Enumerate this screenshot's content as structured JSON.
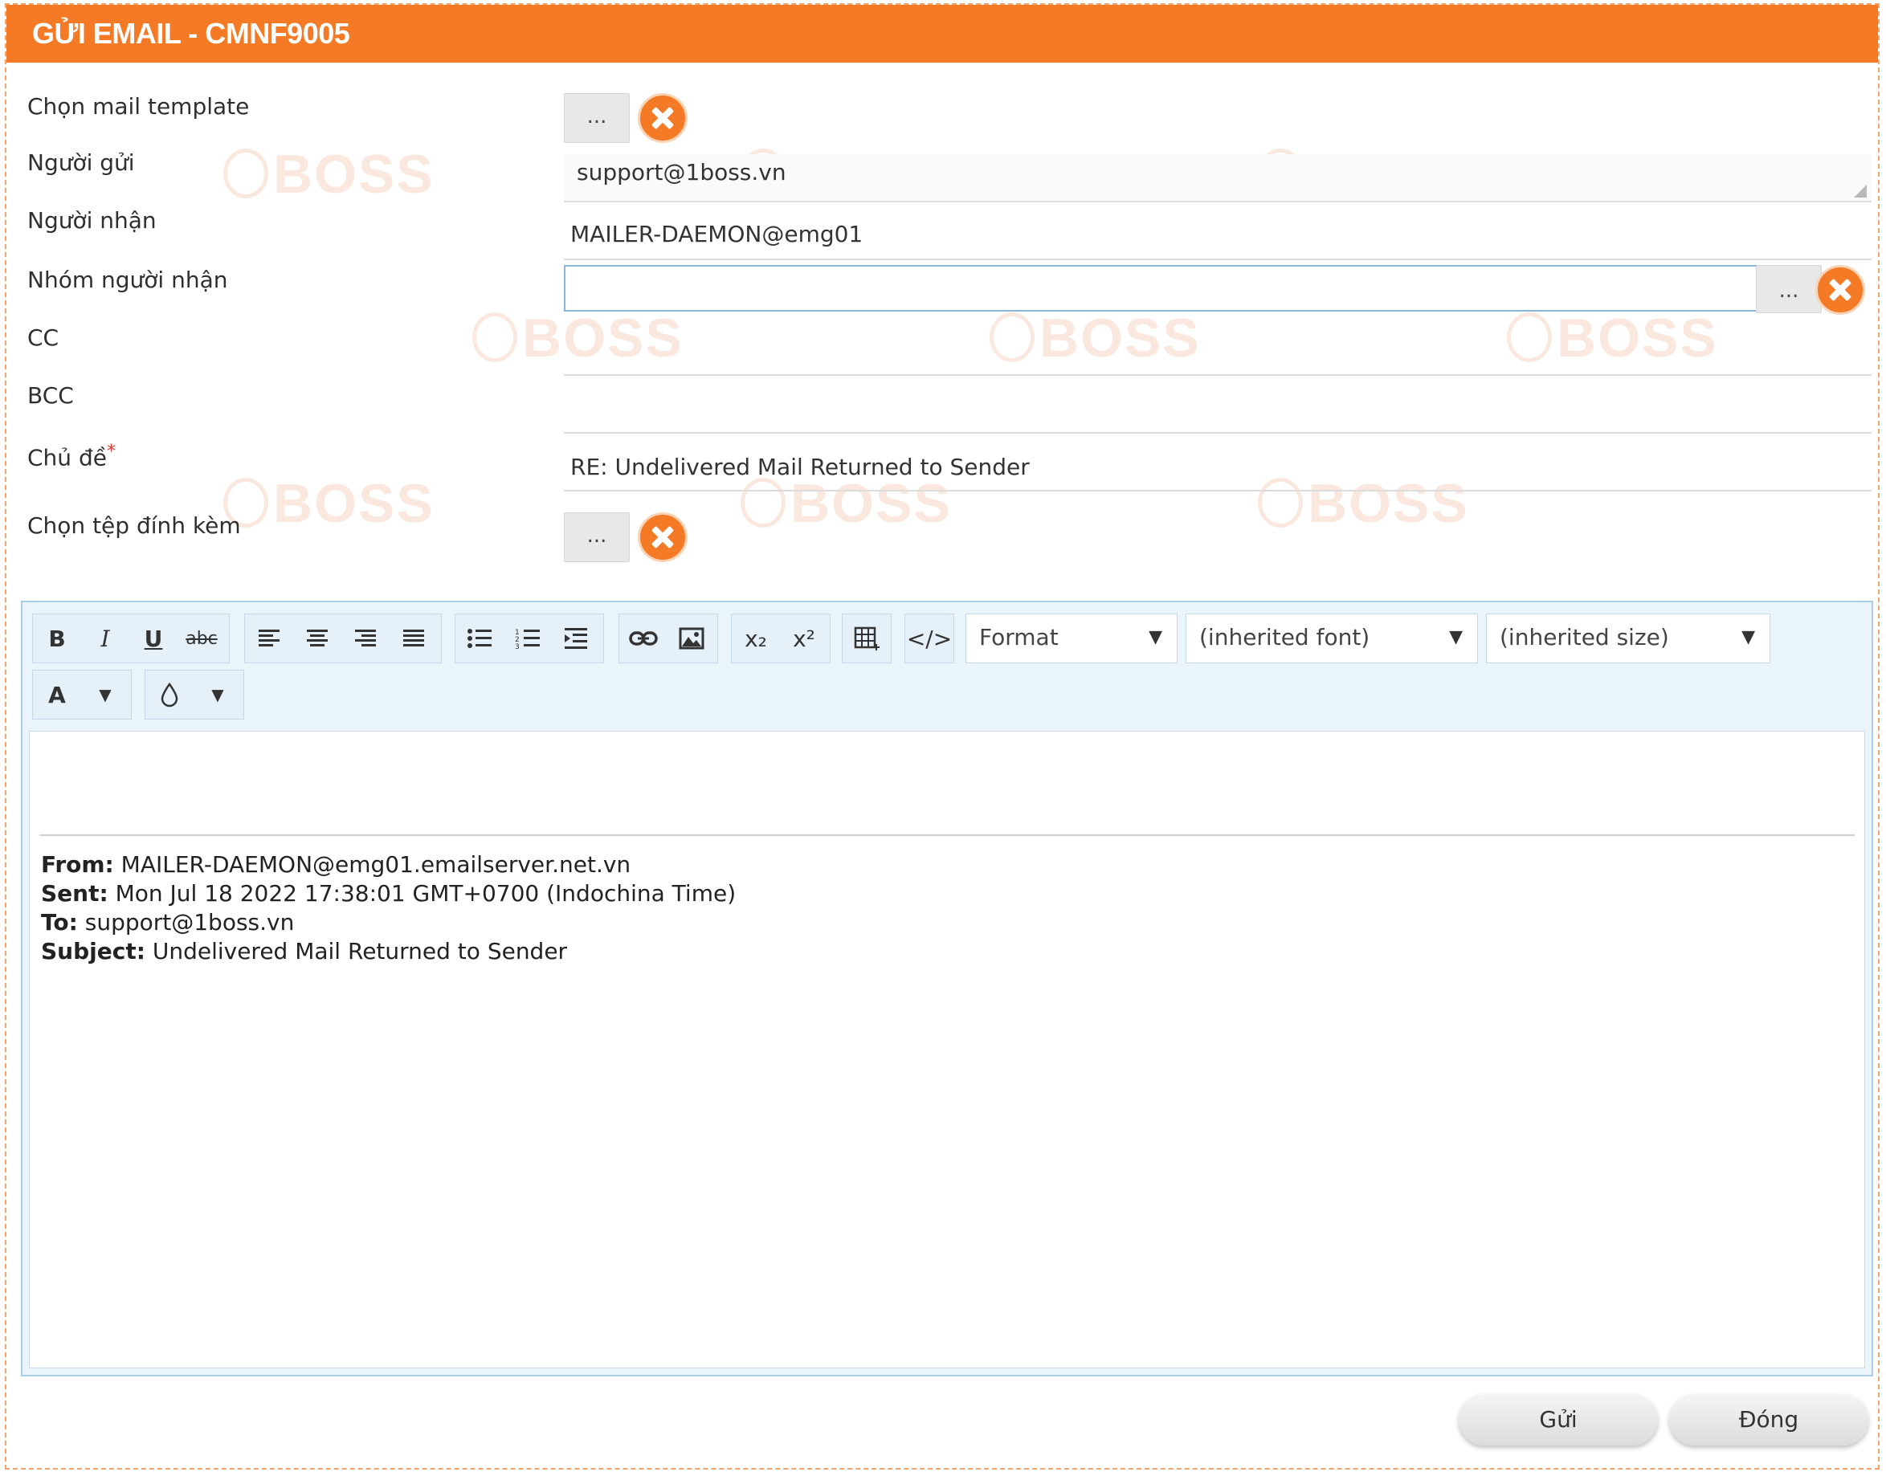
{
  "window": {
    "title": "GỬI EMAIL - CMNF9005"
  },
  "watermark": {
    "text": "BOSS"
  },
  "form": {
    "mail_template": {
      "label": "Chọn mail template",
      "browse_label": "..."
    },
    "sender": {
      "label": "Người gửi",
      "value": "support@1boss.vn"
    },
    "recipient": {
      "label": "Người nhận",
      "value": "MAILER-DAEMON@emg01"
    },
    "recipient_group": {
      "label": "Nhóm người nhận",
      "value": "",
      "browse_label": "..."
    },
    "cc": {
      "label": "CC",
      "value": ""
    },
    "bcc": {
      "label": "BCC",
      "value": ""
    },
    "subject": {
      "label": "Chủ đề",
      "required_mark": "*",
      "value": "RE: Undelivered Mail Returned to Sender"
    },
    "attachment": {
      "label": "Chọn tệp đính kèm",
      "browse_label": "..."
    }
  },
  "editor": {
    "toolbar": {
      "bold": "B",
      "italic": "I",
      "underline": "U",
      "strike": "abc",
      "subscript": "x₂",
      "superscript": "x²",
      "source": "</>",
      "text_color": "A",
      "format": "Format",
      "font": "(inherited font)",
      "size": "(inherited size)",
      "dropdown_arrow": "▼"
    },
    "quote": {
      "from_label": "From:",
      "from_value": " MAILER-DAEMON@emg01.emailserver.net.vn",
      "sent_label": "Sent:",
      "sent_value": " Mon Jul 18 2022 17:38:01 GMT+0700 (Indochina Time)",
      "to_label": "To:",
      "to_value": " support@1boss.vn",
      "subject_label": "Subject:",
      "subject_value": " Undelivered Mail Returned to Sender"
    }
  },
  "footer": {
    "send_label": "Gửi",
    "close_label": "Đóng"
  },
  "colors": {
    "accent": "#f47a25",
    "editor_bg": "#eaf4fb",
    "input_border": "#8cb6d8"
  }
}
